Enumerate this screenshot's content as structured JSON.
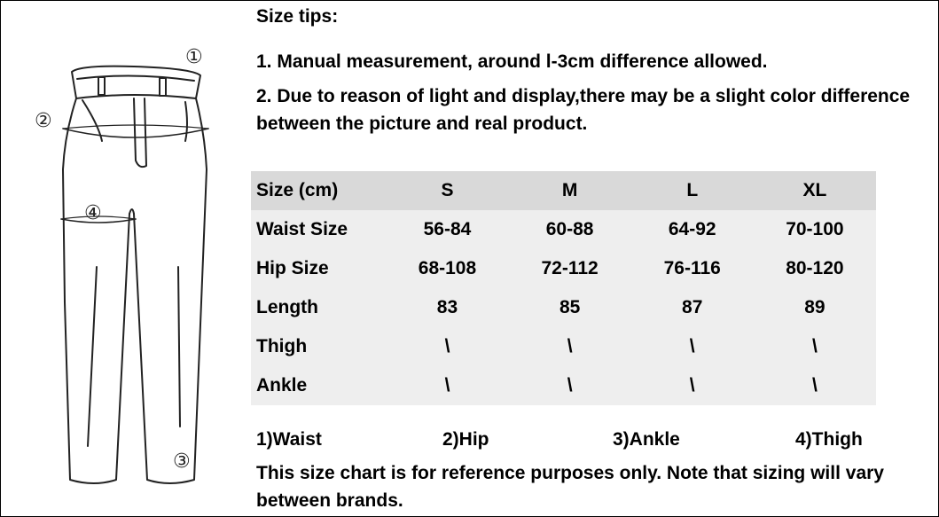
{
  "tips": {
    "title": "Size tips:",
    "tip1": "1. Manual measurement, around l-3cm difference allowed.",
    "tip2": "2. Due to reason of light and display,there may be a slight color difference between the picture and real product."
  },
  "diagram": {
    "markers": [
      "①",
      "②",
      "③",
      "④"
    ]
  },
  "table": {
    "headers": [
      "Size (cm)",
      "S",
      "M",
      "L",
      "XL"
    ],
    "rows": [
      {
        "label": "Waist Size",
        "values": [
          "56-84",
          "60-88",
          "64-92",
          "70-100"
        ]
      },
      {
        "label": "Hip Size",
        "values": [
          "68-108",
          "72-112",
          "76-116",
          "80-120"
        ]
      },
      {
        "label": "Length",
        "values": [
          "83",
          "85",
          "87",
          "89"
        ]
      },
      {
        "label": "Thigh",
        "values": [
          "\\",
          "\\",
          "\\",
          "\\"
        ]
      },
      {
        "label": "Ankle",
        "values": [
          "\\",
          "\\",
          "\\",
          "\\"
        ]
      }
    ]
  },
  "legend": [
    "1)Waist",
    "2)Hip",
    "3)Ankle",
    "4)Thigh"
  ],
  "note": "This size chart is for reference purposes only. Note that sizing will vary between brands.",
  "colors": {
    "header_bg": "#d9d9d9",
    "body_bg": "#eeeeee",
    "line": "#000000"
  }
}
